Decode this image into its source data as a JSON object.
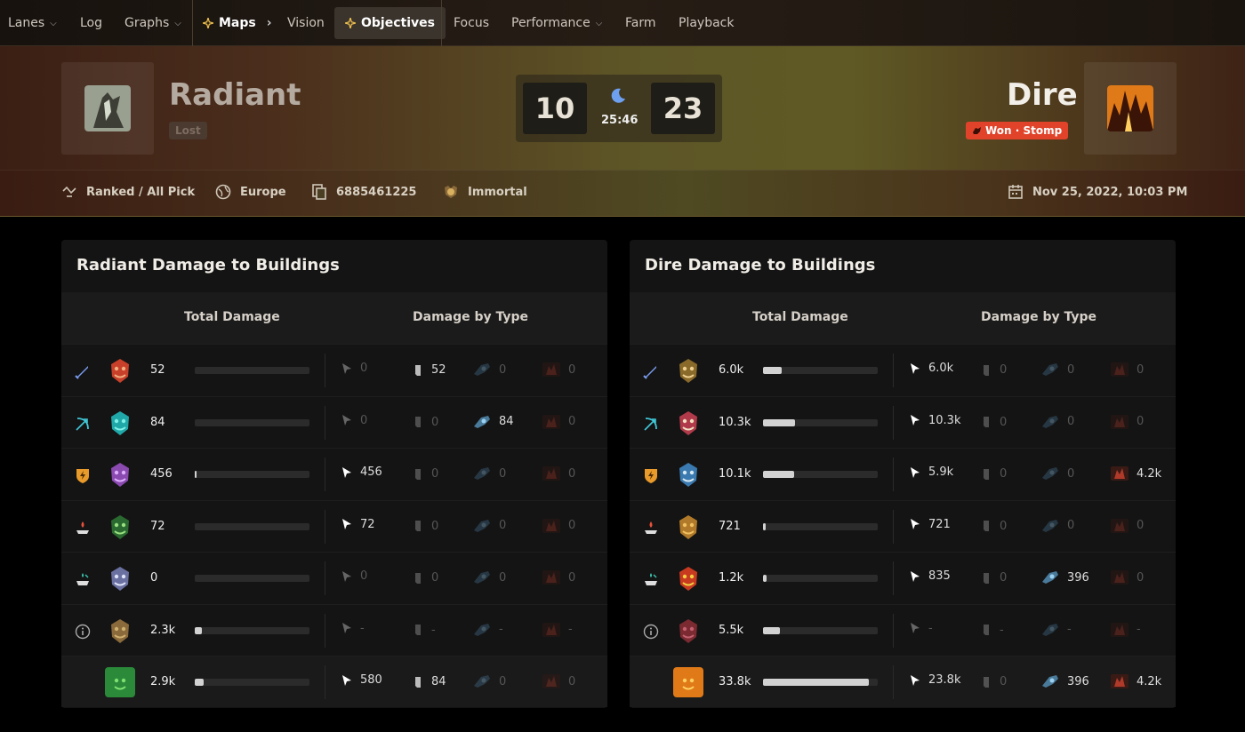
{
  "nav": {
    "items": [
      {
        "label": "Lanes",
        "chevron": true
      },
      {
        "label": "Log"
      },
      {
        "label": "Graphs",
        "chevron": true
      },
      {
        "label": "Maps",
        "chevron": true
      },
      {
        "label": "Vision"
      },
      {
        "label": "Objectives",
        "active": true
      },
      {
        "label": "Focus"
      },
      {
        "label": "Performance",
        "chevron": true
      },
      {
        "label": "Farm"
      },
      {
        "label": "Playback"
      }
    ]
  },
  "header": {
    "radiant": {
      "name": "Radiant",
      "result": "Lost"
    },
    "dire": {
      "name": "Dire",
      "result": "Won · Stomp"
    },
    "score": {
      "radiant": "10",
      "dire": "23",
      "time": "25:46"
    },
    "colors": {
      "won_badge": "#e0432a",
      "lost_badge": "#4a3a30"
    }
  },
  "meta": {
    "mode": "Ranked / All Pick",
    "region": "Europe",
    "match_id": "6885461225",
    "rank": "Immortal",
    "date": "Nov 25, 2022, 10:03 PM"
  },
  "panels": [
    {
      "title": "Radiant Damage to Buildings",
      "col_total": "Total Damage",
      "col_type": "Damage by Type",
      "rows": [
        {
          "role": "sword",
          "total": "52",
          "fill": 0.0,
          "hero": "0",
          "creep": "52",
          "siege": "0",
          "summon": "0",
          "other": "0"
        },
        {
          "role": "bow",
          "total": "84",
          "fill": 0.0,
          "hero": "0",
          "creep": "0",
          "siege": "84",
          "summon": "0",
          "other": "0"
        },
        {
          "role": "bolt",
          "total": "456",
          "fill": 0.01,
          "hero": "456",
          "creep": "0",
          "siege": "0",
          "summon": "0",
          "other": "0"
        },
        {
          "role": "candle",
          "total": "72",
          "fill": 0.0,
          "hero": "72",
          "creep": "0",
          "siege": "0",
          "summon": "0",
          "other": "0"
        },
        {
          "role": "support",
          "total": "0",
          "fill": 0.0,
          "hero": "0",
          "creep": "0",
          "siege": "0",
          "summon": "0",
          "other": "0"
        },
        {
          "role": "info",
          "total": "2.3k",
          "fill": 0.06,
          "hero": "-",
          "creep": "-",
          "siege": "-",
          "summon": "-",
          "other": "-"
        },
        {
          "role": "",
          "total": "2.9k",
          "fill": 0.08,
          "hero": "580",
          "creep": "84",
          "siege": "0",
          "summon": "0",
          "other": "0",
          "is_total": true
        }
      ]
    },
    {
      "title": "Dire Damage to Buildings",
      "col_total": "Total Damage",
      "col_type": "Damage by Type",
      "rows": [
        {
          "role": "sword",
          "total": "6.0k",
          "fill": 0.16,
          "hero": "6.0k",
          "creep": "0",
          "siege": "0",
          "summon": "0"
        },
        {
          "role": "bow",
          "total": "10.3k",
          "fill": 0.28,
          "hero": "10.3k",
          "creep": "0",
          "siege": "0",
          "summon": "0"
        },
        {
          "role": "bolt",
          "total": "10.1k",
          "fill": 0.27,
          "hero": "5.9k",
          "creep": "0",
          "siege": "0",
          "summon": "4.2k"
        },
        {
          "role": "candle",
          "total": "721",
          "fill": 0.02,
          "hero": "721",
          "creep": "0",
          "siege": "0",
          "summon": "0"
        },
        {
          "role": "support",
          "total": "1.2k",
          "fill": 0.03,
          "hero": "835",
          "creep": "0",
          "siege": "396",
          "summon": "0"
        },
        {
          "role": "info",
          "total": "5.5k",
          "fill": 0.15,
          "hero": "-",
          "creep": "-",
          "siege": "-",
          "summon": "-"
        },
        {
          "role": "",
          "total": "33.8k",
          "fill": 0.92,
          "hero": "23.8k",
          "creep": "0",
          "siege": "396",
          "summon": "4.2k",
          "is_total": true
        }
      ]
    }
  ]
}
